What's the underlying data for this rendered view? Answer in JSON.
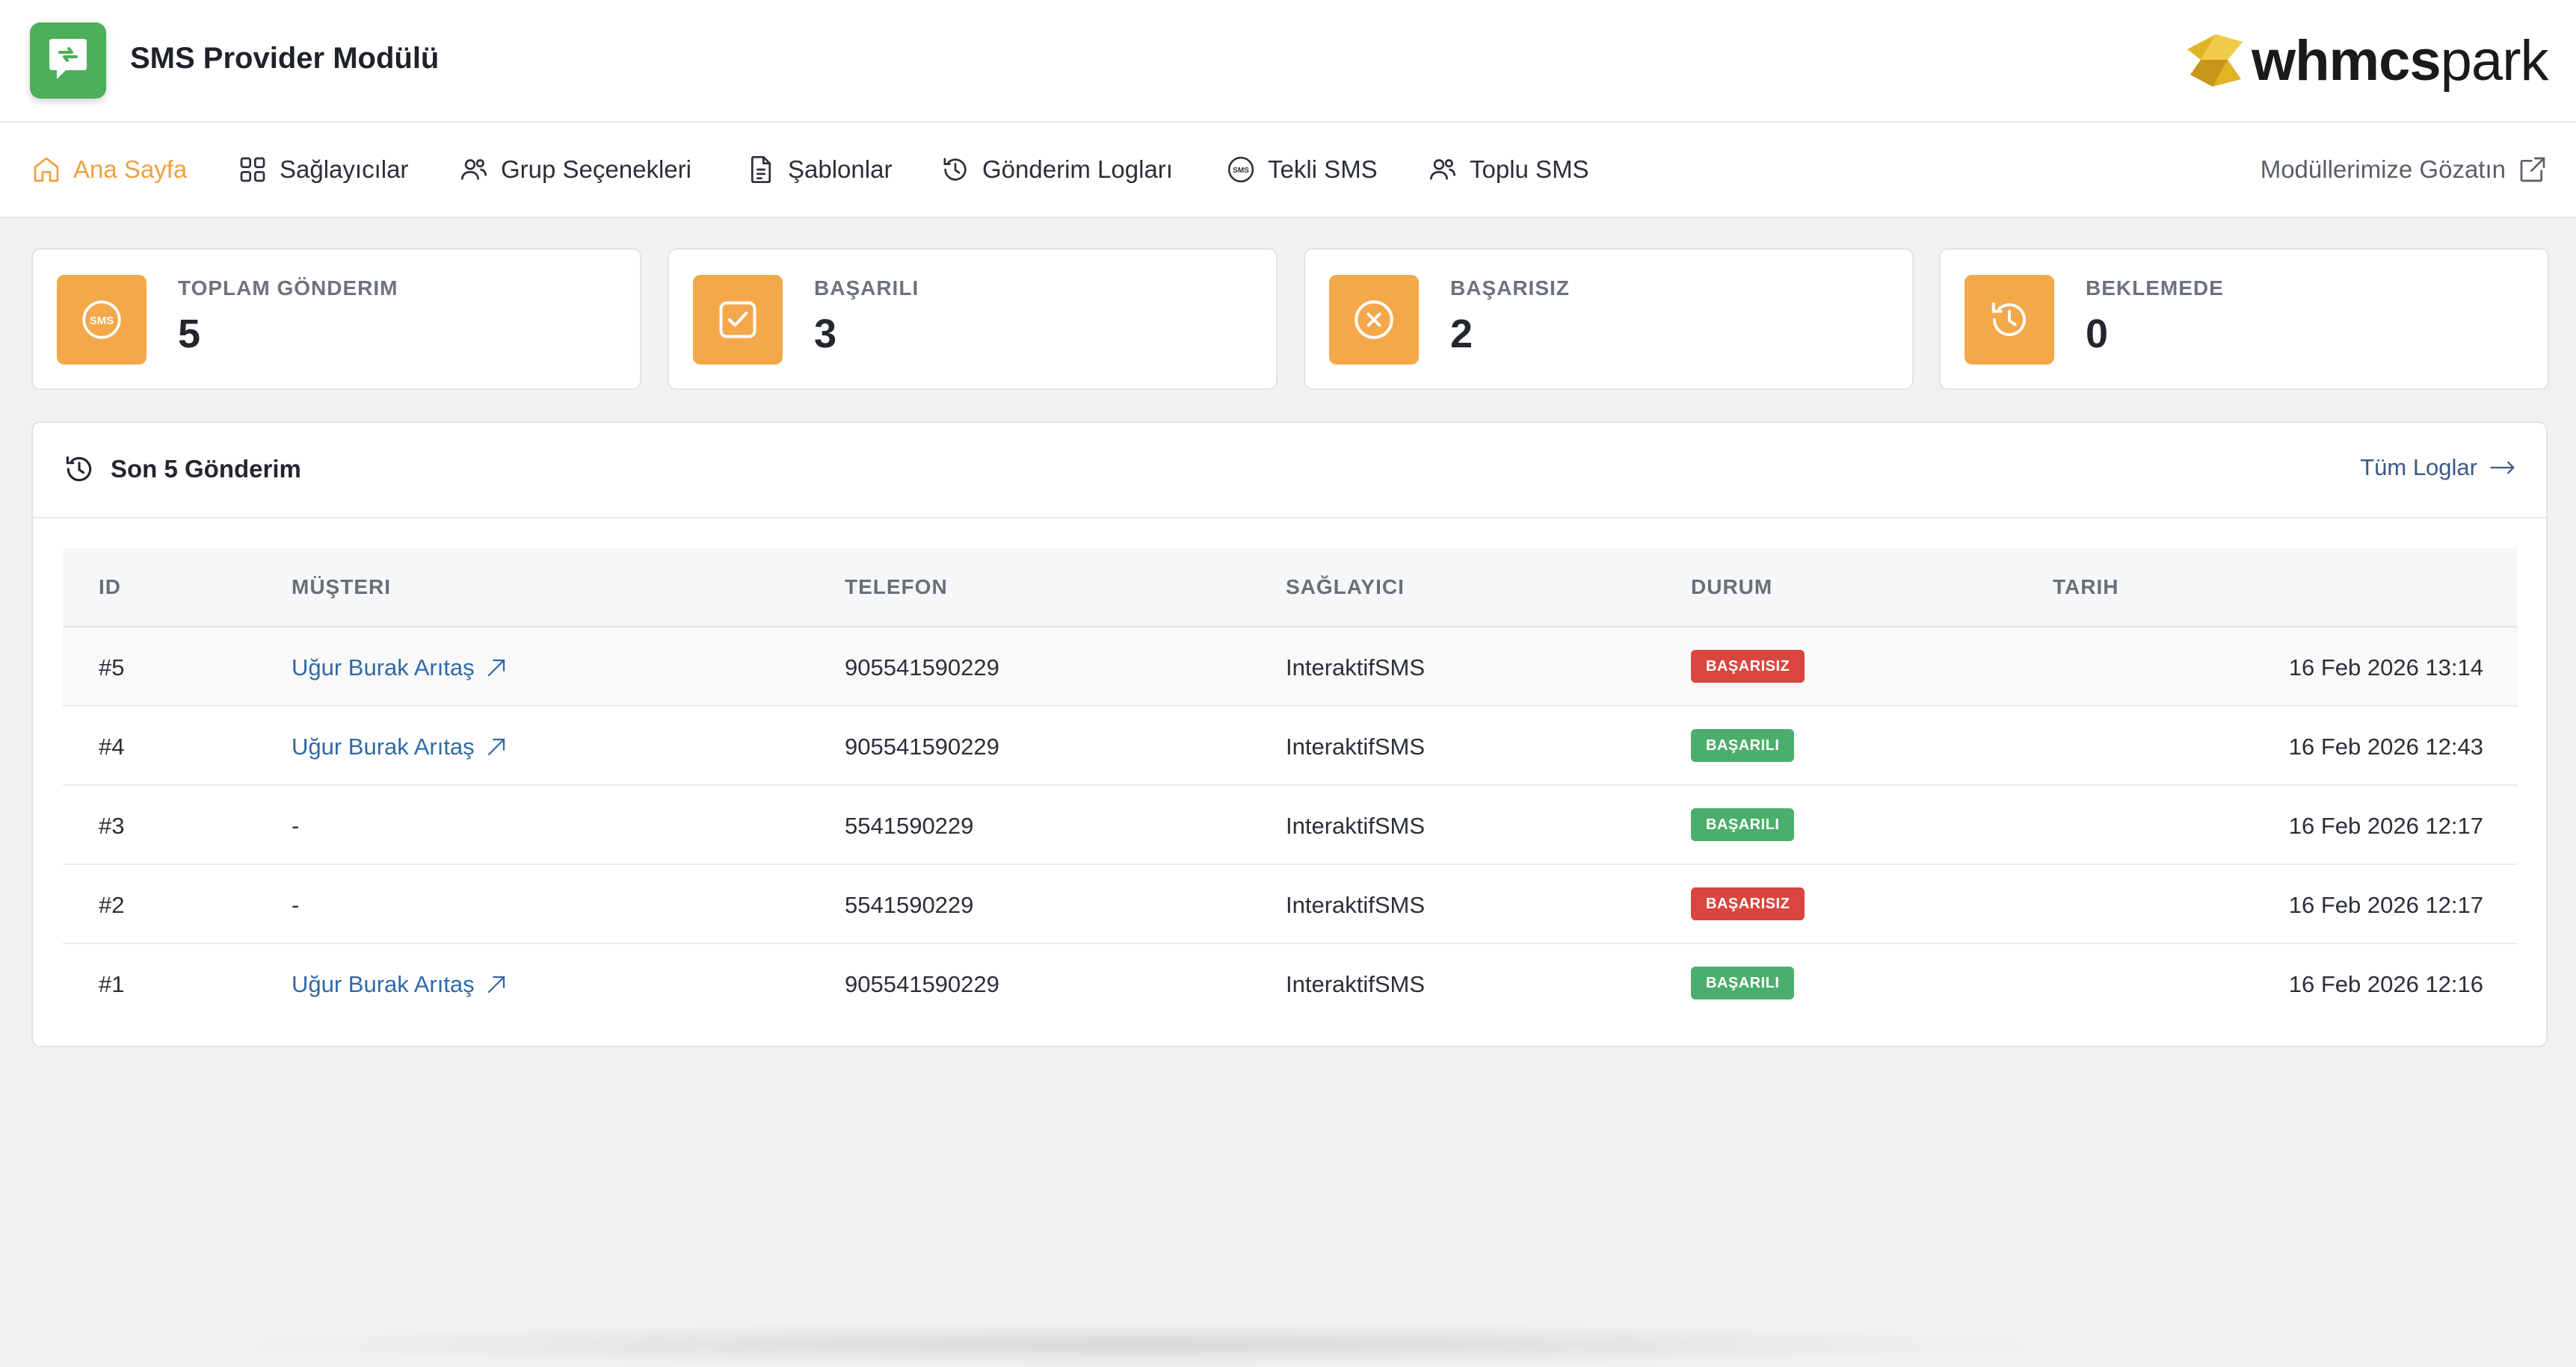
{
  "header": {
    "app_title": "SMS Provider Modülü",
    "brand_bold": "whmcs",
    "brand_light": "park",
    "accent_color": "#f0a03c",
    "logo_color": "#4caf5a"
  },
  "nav": {
    "items": [
      {
        "label": "Ana Sayfa",
        "icon": "home-icon",
        "active": true
      },
      {
        "label": "Sağlayıcılar",
        "icon": "grid-icon"
      },
      {
        "label": "Grup Seçenekleri",
        "icon": "users-icon"
      },
      {
        "label": "Şablonlar",
        "icon": "document-icon"
      },
      {
        "label": "Gönderim Logları",
        "icon": "history-icon"
      },
      {
        "label": "Tekli SMS",
        "icon": "sms-icon"
      },
      {
        "label": "Toplu SMS",
        "icon": "users-icon"
      }
    ],
    "external_link": "Modüllerimize Gözatın"
  },
  "stats": [
    {
      "label": "TOPLAM GÖNDERIM",
      "value": "5",
      "icon": "sms-bubble-icon"
    },
    {
      "label": "BAŞARILI",
      "value": "3",
      "icon": "check-square-icon"
    },
    {
      "label": "BAŞARISIZ",
      "value": "2",
      "icon": "x-circle-icon"
    },
    {
      "label": "BEKLEMEDE",
      "value": "0",
      "icon": "history-icon"
    }
  ],
  "recent": {
    "title": "Son 5 Gönderim",
    "all_logs_link": "Tüm Loglar",
    "columns": [
      "ID",
      "MÜŞTERI",
      "TELEFON",
      "SAĞLAYICI",
      "DURUM",
      "TARIH"
    ],
    "rows": [
      {
        "id": "#5",
        "customer": "Uğur Burak Arıtaş",
        "phone": "905541590229",
        "provider": "InteraktifSMS",
        "status": "BAŞARISIZ",
        "status_type": "fail",
        "date": "16 Feb 2026 13:14"
      },
      {
        "id": "#4",
        "customer": "Uğur Burak Arıtaş",
        "phone": "905541590229",
        "provider": "InteraktifSMS",
        "status": "BAŞARILI",
        "status_type": "ok",
        "date": "16 Feb 2026 12:43"
      },
      {
        "id": "#3",
        "customer": "-",
        "phone": "5541590229",
        "provider": "InteraktifSMS",
        "status": "BAŞARILI",
        "status_type": "ok",
        "date": "16 Feb 2026 12:17"
      },
      {
        "id": "#2",
        "customer": "-",
        "phone": "5541590229",
        "provider": "InteraktifSMS",
        "status": "BAŞARISIZ",
        "status_type": "fail",
        "date": "16 Feb 2026 12:17"
      },
      {
        "id": "#1",
        "customer": "Uğur Burak Arıtaş",
        "phone": "905541590229",
        "provider": "InteraktifSMS",
        "status": "BAŞARILI",
        "status_type": "ok",
        "date": "16 Feb 2026 12:16"
      }
    ],
    "status_colors": {
      "fail": "#d9453f",
      "ok": "#4cae6c"
    }
  }
}
